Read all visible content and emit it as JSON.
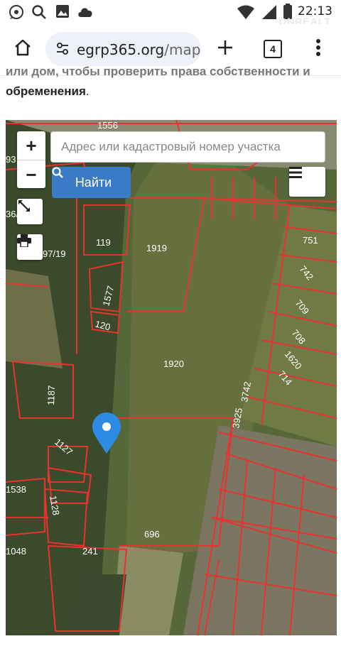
{
  "status_bar": {
    "time": "22:13",
    "watermark": "ONREALT"
  },
  "browser": {
    "url_domain": "egrp365.org",
    "url_path": "/map",
    "tab_count": "4"
  },
  "article": {
    "cut_line": "или дом, чтобы проверить права собственности и",
    "line2_bold": "обременения",
    "line2_end": "."
  },
  "map_ui": {
    "zoom_in": "+",
    "zoom_out": "−",
    "search_placeholder": "Адрес или кадастровый номер участка",
    "find_button": "Найти"
  },
  "parcels": [
    {
      "label": "1556"
    },
    {
      "label": "1919"
    },
    {
      "label": "119"
    },
    {
      "label": "97/19"
    },
    {
      "label": "1577"
    },
    {
      "label": "120"
    },
    {
      "label": "1920"
    },
    {
      "label": "751"
    },
    {
      "label": "742"
    },
    {
      "label": "709"
    },
    {
      "label": "708"
    },
    {
      "label": "1620"
    },
    {
      "label": "714"
    },
    {
      "label": "3742"
    },
    {
      "label": "3925"
    },
    {
      "label": "1187"
    },
    {
      "label": "1127"
    },
    {
      "label": "1128"
    },
    {
      "label": "1538"
    },
    {
      "label": "696"
    },
    {
      "label": "241"
    },
    {
      "label": "1048"
    },
    {
      "label": "36/"
    },
    {
      "label": "93"
    }
  ],
  "colors": {
    "parcel_border": "#e8322f",
    "button_blue": "#3a7bc8",
    "marker_blue": "#2d8be3"
  }
}
